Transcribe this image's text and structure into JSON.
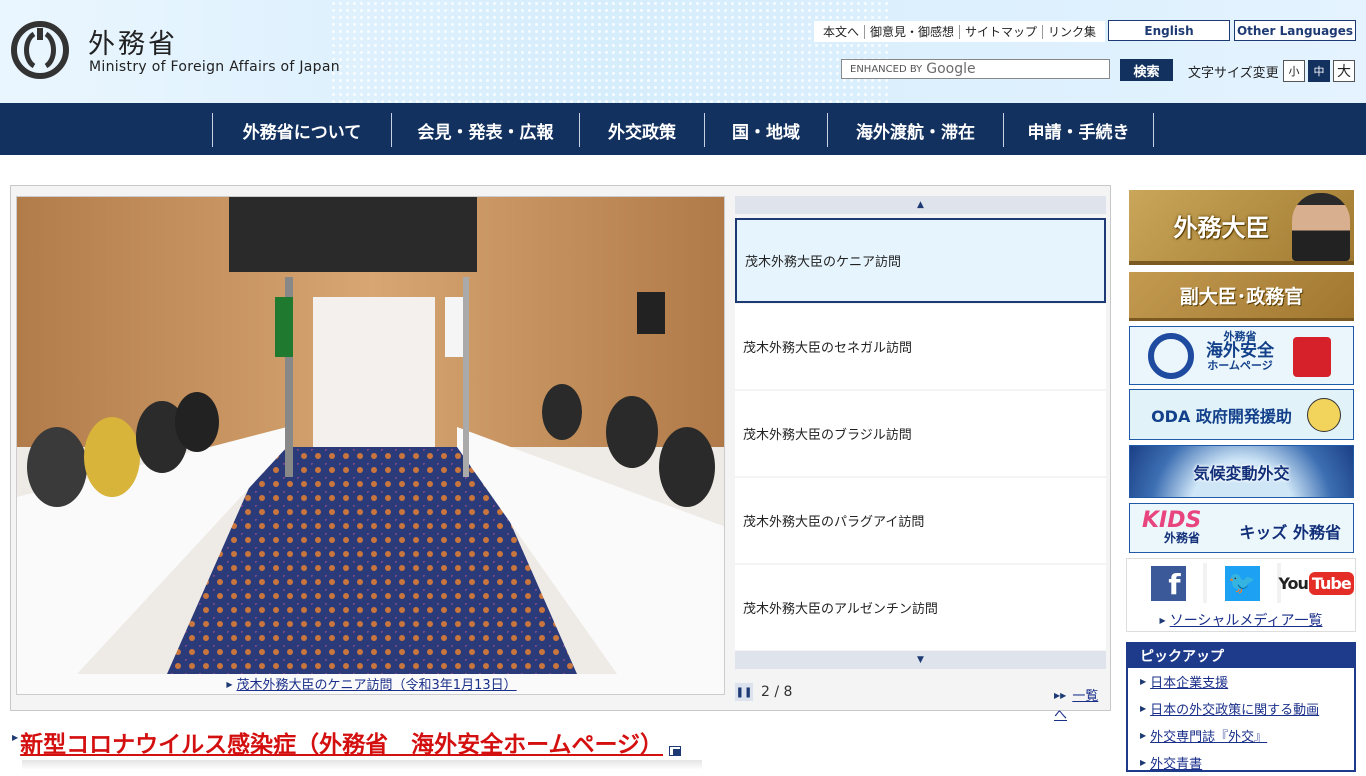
{
  "header": {
    "logo_jp": "外務省",
    "logo_en": "Ministry of Foreign Affairs of Japan",
    "util_links": [
      "本文へ",
      "御意見・御感想",
      "サイトマップ",
      "リンク集"
    ],
    "english_label": "English",
    "other_languages_label": "Other Languages",
    "search_enhanced": "ENHANCED BY",
    "search_brand": "Google",
    "search_button": "検索",
    "fontsize_label": "文字サイズ変更",
    "fontsize_options": [
      "小",
      "中",
      "大"
    ],
    "fontsize_selected": "中"
  },
  "nav": {
    "items": [
      "外務省について",
      "会見・発表・広報",
      "外交政策",
      "国・地域",
      "海外渡航・滞在",
      "申請・手続き"
    ]
  },
  "slider": {
    "caption": "茂木外務大臣のケニア訪問（令和3年1月13日）",
    "items": [
      "茂木外務大臣のケニア訪問",
      "茂木外務大臣のセネガル訪問",
      "茂木外務大臣のブラジル訪問",
      "茂木外務大臣のパラグアイ訪問",
      "茂木外務大臣のアルゼンチン訪問"
    ],
    "page_counter": "2 / 8",
    "list_link": "一覧へ"
  },
  "headline": {
    "text": "新型コロナウイルス感染症（外務省　海外安全ホームページ）"
  },
  "sidebar": {
    "banner_minister": "外務大臣",
    "banner_vice": "副大臣･政務官",
    "banner_anzen_1": "外務省",
    "banner_anzen_2": "海外安全",
    "banner_anzen_3": "ホームページ",
    "banner_oda": "ODA 政府開発援助",
    "banner_climate": "気候変動外交",
    "banner_kids_logo": "KIDS",
    "banner_kids_sub": "外務省",
    "banner_kids_label": "キッズ 外務省",
    "social_youtube": "You",
    "social_youtube_tube": "Tube",
    "social_link": "ソーシャルメディア一覧",
    "pickup_title": "ピックアップ",
    "pickup_items": [
      "日本企業支援",
      "日本の外交政策に関する動画",
      "外交専門誌『外交』",
      "外交青書"
    ]
  },
  "colors": {
    "navy": "#12315e",
    "link": "#1a2f8a",
    "headline_red": "#d40f0f"
  }
}
